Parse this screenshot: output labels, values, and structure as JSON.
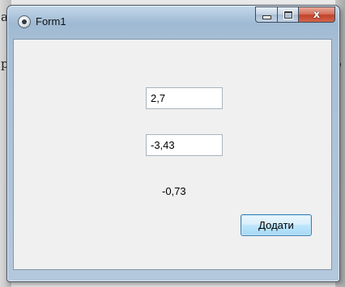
{
  "window": {
    "title": "Form1",
    "controls": {
      "minimize_icon": "minimize-icon",
      "maximize_icon": "maximize-icon",
      "close_icon": "close-icon",
      "close_glyph": "x"
    }
  },
  "form": {
    "input1": {
      "value": "2,7"
    },
    "input2": {
      "value": "-3,43"
    },
    "result": "-0,73",
    "add_button": "Додати"
  },
  "background": {
    "fragments": [
      "а",
      "р",
      "р"
    ]
  }
}
